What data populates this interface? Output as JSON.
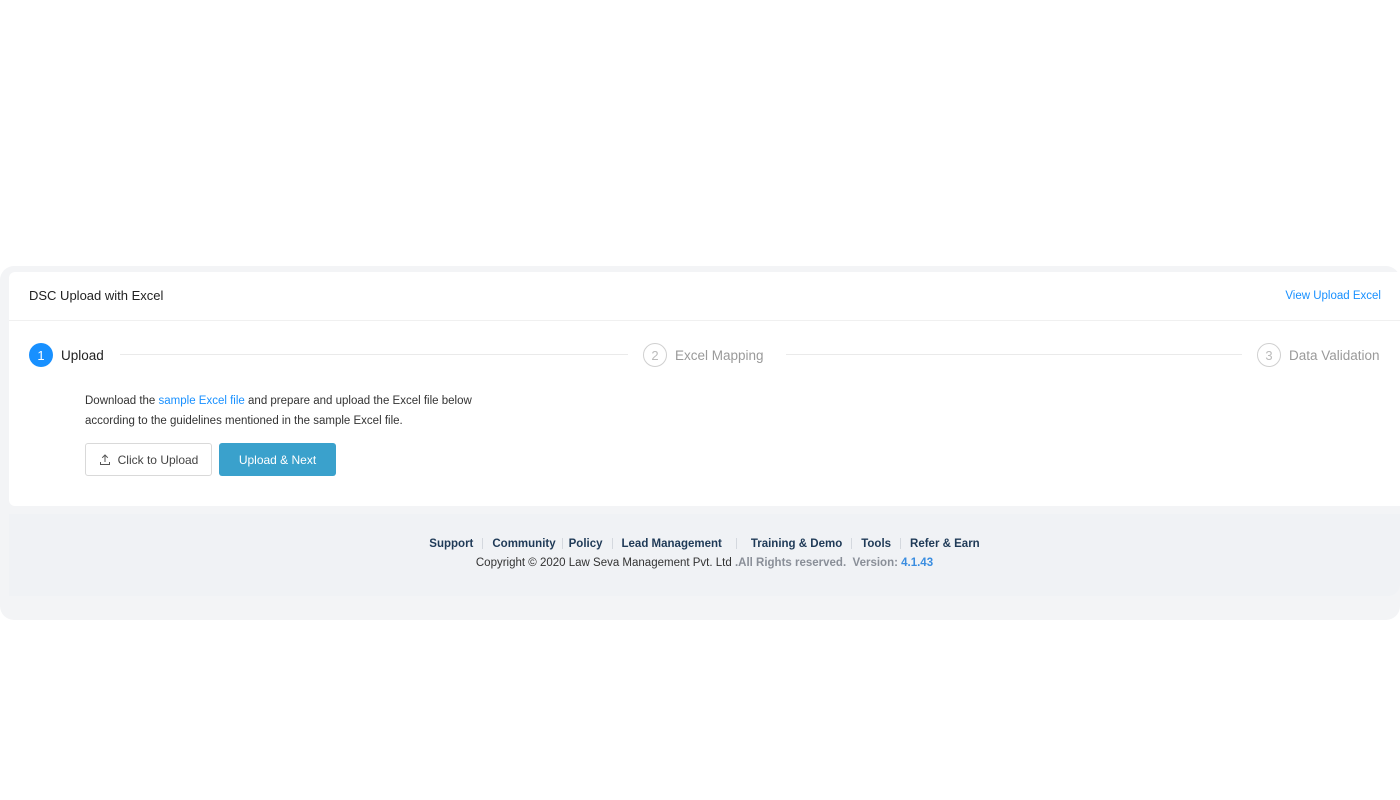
{
  "card": {
    "title": "DSC Upload with Excel",
    "view_link": "View Upload Excel"
  },
  "steps": [
    {
      "number": "1",
      "label": "Upload",
      "status": "active"
    },
    {
      "number": "2",
      "label": "Excel Mapping",
      "status": "wait"
    },
    {
      "number": "3",
      "label": "Data Validation",
      "status": "wait"
    }
  ],
  "instructions": {
    "prefix": "Download the ",
    "link": "sample Excel file",
    "suffix": " and prepare and upload the Excel file below according to the guidelines mentioned in the sample Excel file."
  },
  "buttons": {
    "upload_label": "Click to Upload",
    "upload_icon": "upload-icon",
    "next_label": "Upload & Next"
  },
  "footer": {
    "links": [
      "Support",
      "Community",
      "Policy",
      "Lead Management",
      "Training & Demo",
      "Tools",
      "Refer & Earn"
    ],
    "copyright": "Copyright © 2020 Law Seva Management Pvt. Ltd",
    "rights": " .All Rights reserved.",
    "version_label": "Version: ",
    "version": "4.1.43"
  },
  "colors": {
    "primary": "#1890ff",
    "button_primary": "#3aa1cc",
    "footer_bg": "#f0f2f5",
    "footer_link": "#1f3a57"
  }
}
